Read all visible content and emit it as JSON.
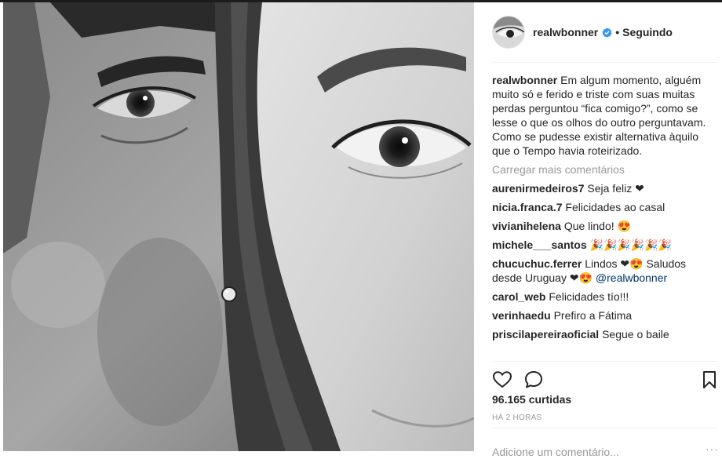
{
  "post": {
    "author": "realwbonner",
    "follow_status": "Seguindo",
    "separator": "•",
    "caption": "Em algum momento, alguém muito só e ferido e triste com suas muitas perdas perguntou “fica comigo?”, como se lesse o que os olhos do outro perguntavam. Como se pudesse existir alternativa àquilo que o Tempo havia roteirizado.",
    "load_more": "Carregar mais comentários",
    "comments": [
      {
        "user": "aurenirmedeiros7",
        "text": "Seja feliz ❤"
      },
      {
        "user": "nicia.franca.7",
        "text": "Felicidades ao casal"
      },
      {
        "user": "vivianihelena",
        "text": "Que lindo! 😍"
      },
      {
        "user": "michele___santos",
        "text": "🎉🎉🎉🎉🎉🎉"
      },
      {
        "user": "chucuchuc.ferrer",
        "text": "Lindos ❤😍 Saludos desde Uruguay ❤😍",
        "mention": "@realwbonner"
      },
      {
        "user": "carol_web",
        "text": "Felicidades tío!!!"
      },
      {
        "user": "verinhaedu",
        "text": "Prefiro a Fátima"
      },
      {
        "user": "priscilapereiraoficial",
        "text": "Segue o baile"
      }
    ],
    "likes": "96.165 curtidas",
    "time": "HÁ 2 HORAS",
    "add_comment_placeholder": "Adicione um comentário...",
    "more_dots": "···"
  },
  "colors": {
    "verified": "#3897f0",
    "text": "#262626",
    "muted": "#999999",
    "mention": "#003569"
  },
  "icons": [
    "heart-icon",
    "comment-icon",
    "bookmark-icon",
    "verified-icon"
  ]
}
